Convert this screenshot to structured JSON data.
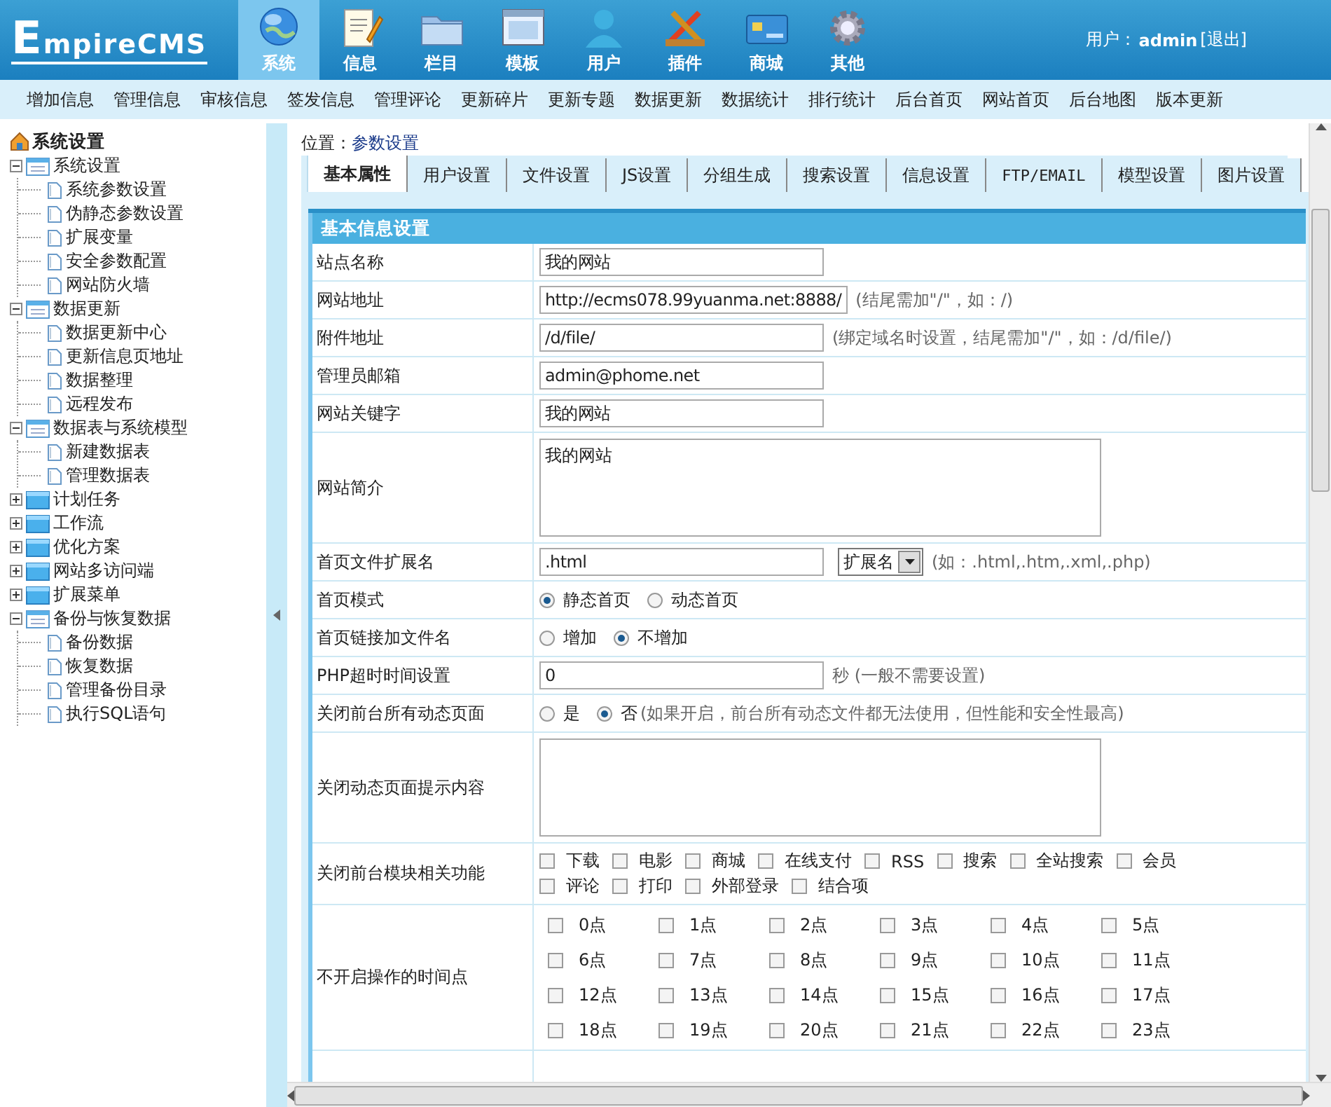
{
  "logo": "EmpireCMS",
  "main_nav": [
    {
      "label": "系统",
      "selected": true
    },
    {
      "label": "信息",
      "selected": false
    },
    {
      "label": "栏目",
      "selected": false
    },
    {
      "label": "模板",
      "selected": false
    },
    {
      "label": "用户",
      "selected": false
    },
    {
      "label": "插件",
      "selected": false
    },
    {
      "label": "商城",
      "selected": false
    },
    {
      "label": "其他",
      "selected": false
    }
  ],
  "user": {
    "label": "用户：",
    "name": "admin",
    "logout": "[退出]"
  },
  "sub_nav": [
    "增加信息",
    "管理信息",
    "审核信息",
    "签发信息",
    "管理评论",
    "更新碎片",
    "更新专题",
    "数据更新",
    "数据统计",
    "排行统计",
    "后台首页",
    "网站首页",
    "后台地图",
    "版本更新"
  ],
  "sidebar": {
    "title": "系统设置",
    "items": [
      {
        "label": "系统设置",
        "expanded": true,
        "children": [
          {
            "label": "系统参数设置"
          },
          {
            "label": "伪静态参数设置"
          },
          {
            "label": "扩展变量"
          },
          {
            "label": "安全参数配置"
          },
          {
            "label": "网站防火墙"
          }
        ]
      },
      {
        "label": "数据更新",
        "expanded": true,
        "children": [
          {
            "label": "数据更新中心"
          },
          {
            "label": "更新信息页地址"
          },
          {
            "label": "数据整理"
          },
          {
            "label": "远程发布"
          }
        ]
      },
      {
        "label": "数据表与系统模型",
        "expanded": true,
        "children": [
          {
            "label": "新建数据表"
          },
          {
            "label": "管理数据表"
          }
        ]
      },
      {
        "label": "计划任务",
        "expanded": false
      },
      {
        "label": "工作流",
        "expanded": false
      },
      {
        "label": "优化方案",
        "expanded": false
      },
      {
        "label": "网站多访问端",
        "expanded": false
      },
      {
        "label": "扩展菜单",
        "expanded": false
      },
      {
        "label": "备份与恢复数据",
        "expanded": true,
        "children": [
          {
            "label": "备份数据"
          },
          {
            "label": "恢复数据"
          },
          {
            "label": "管理备份目录"
          },
          {
            "label": "执行SQL语句"
          }
        ]
      }
    ]
  },
  "location": {
    "label": "位置：",
    "link": "参数设置"
  },
  "tabs": [
    {
      "label": "基本属性",
      "selected": true
    },
    {
      "label": "用户设置",
      "selected": false
    },
    {
      "label": "文件设置",
      "selected": false
    },
    {
      "label": "JS设置",
      "selected": false
    },
    {
      "label": "分组生成",
      "selected": false
    },
    {
      "label": "搜索设置",
      "selected": false
    },
    {
      "label": "信息设置",
      "selected": false
    },
    {
      "label": "FTP/EMAIL",
      "selected": false
    },
    {
      "label": "模型设置",
      "selected": false
    },
    {
      "label": "图片设置",
      "selected": false
    }
  ],
  "section_title": "基本信息设置",
  "rows": [
    {
      "kind": "text",
      "label": "站点名称",
      "value": "我的网站"
    },
    {
      "kind": "text",
      "label": "网站地址",
      "value": "http://ecms078.99yuanma.net:8888/",
      "hint": "(结尾需加\"/\"，如：/)"
    },
    {
      "kind": "text",
      "label": "附件地址",
      "value": "/d/file/",
      "hint": "(绑定域名时设置，结尾需加\"/\"，如：/d/file/)"
    },
    {
      "kind": "text",
      "label": "管理员邮箱",
      "value": "admin@phome.net"
    },
    {
      "kind": "text",
      "label": "网站关键字",
      "value": "我的网站"
    },
    {
      "kind": "textarea",
      "label": "网站简介",
      "value": "我的网站"
    },
    {
      "kind": "select",
      "label": "首页文件扩展名",
      "value": ".html",
      "select": "扩展名",
      "hint": "(如：.html,.htm,.xml,.php)"
    },
    {
      "kind": "radio",
      "label": "首页模式",
      "options": [
        {
          "label": "静态首页",
          "selected": true
        },
        {
          "label": "动态首页",
          "selected": false
        }
      ]
    },
    {
      "kind": "radio",
      "label": "首页链接加文件名",
      "options": [
        {
          "label": "增加",
          "selected": false
        },
        {
          "label": "不增加",
          "selected": true
        }
      ]
    },
    {
      "kind": "text",
      "label": "PHP超时时间设置",
      "value": "0",
      "hint": "秒 (一般不需要设置)"
    },
    {
      "kind": "radio",
      "label": "关闭前台所有动态页面",
      "options": [
        {
          "label": "是",
          "selected": false
        },
        {
          "label": "否",
          "selected": true
        }
      ],
      "hint": "(如果开启，前台所有动态文件都无法使用，但性能和安全性最高)"
    },
    {
      "kind": "textarea",
      "label": "关闭动态页面提示内容",
      "value": ""
    },
    {
      "kind": "checks",
      "label": "关闭前台模块相关功能",
      "options": [
        {
          "label": "下载",
          "checked": false
        },
        {
          "label": "电影",
          "checked": false
        },
        {
          "label": "商城",
          "checked": false
        },
        {
          "label": "在线支付",
          "checked": false
        },
        {
          "label": "RSS",
          "checked": false
        },
        {
          "label": "搜索",
          "checked": false
        },
        {
          "label": "全站搜索",
          "checked": false
        },
        {
          "label": "会员",
          "checked": false
        },
        {
          "label": "评论",
          "checked": false
        },
        {
          "label": "打印",
          "checked": false
        },
        {
          "label": "外部登录",
          "checked": false
        },
        {
          "label": "结合项",
          "checked": false
        }
      ]
    },
    {
      "kind": "hours",
      "label": "不开启操作的时间点",
      "options": [
        {
          "label": "0点",
          "checked": false
        },
        {
          "label": "1点",
          "checked": false
        },
        {
          "label": "2点",
          "checked": false
        },
        {
          "label": "3点",
          "checked": false
        },
        {
          "label": "4点",
          "checked": false
        },
        {
          "label": "5点",
          "checked": false
        },
        {
          "label": "6点",
          "checked": false
        },
        {
          "label": "7点",
          "checked": false
        },
        {
          "label": "8点",
          "checked": false
        },
        {
          "label": "9点",
          "checked": false
        },
        {
          "label": "10点",
          "checked": false
        },
        {
          "label": "11点",
          "checked": false
        },
        {
          "label": "12点",
          "checked": false
        },
        {
          "label": "13点",
          "checked": false
        },
        {
          "label": "14点",
          "checked": false
        },
        {
          "label": "15点",
          "checked": false
        },
        {
          "label": "16点",
          "checked": false
        },
        {
          "label": "17点",
          "checked": false
        },
        {
          "label": "18点",
          "checked": false
        },
        {
          "label": "19点",
          "checked": false
        },
        {
          "label": "20点",
          "checked": false
        },
        {
          "label": "21点",
          "checked": false
        },
        {
          "label": "22点",
          "checked": false
        },
        {
          "label": "23点",
          "checked": false
        }
      ]
    }
  ]
}
